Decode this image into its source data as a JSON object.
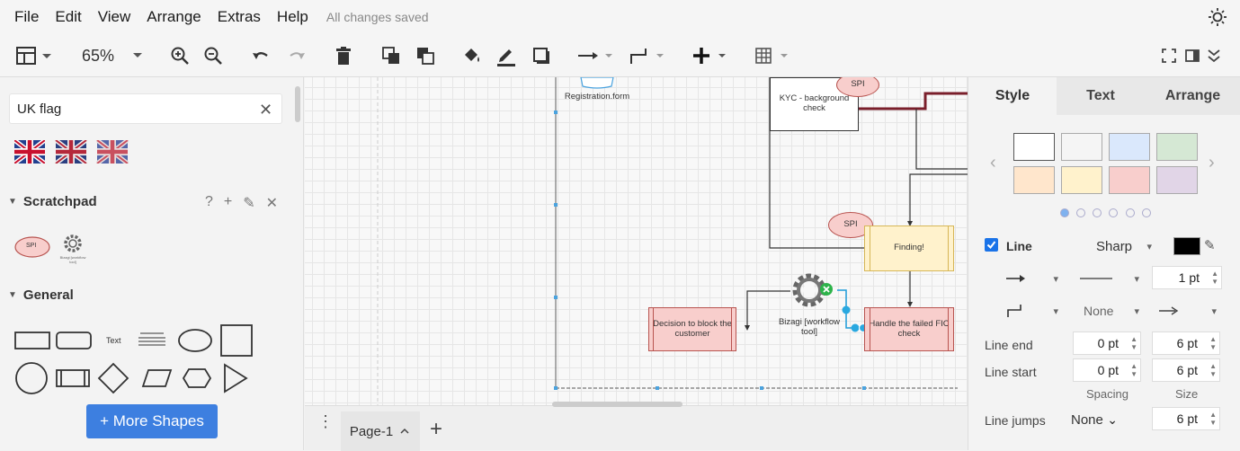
{
  "menu": {
    "file": "File",
    "edit": "Edit",
    "view": "View",
    "arrange": "Arrange",
    "extras": "Extras",
    "help": "Help",
    "status": "All changes saved"
  },
  "toolbar": {
    "zoom": "65%"
  },
  "sidebar": {
    "search": {
      "value": "UK flag"
    },
    "scratchpad": {
      "title": "Scratchpad",
      "help": "?",
      "add": "+"
    },
    "general": {
      "title": "General"
    },
    "scratch_items": {
      "spi": "SPI",
      "gear_caption": "Bizagi [workflow tool]"
    },
    "shape_text": "Text",
    "more_shapes": "+ More Shapes"
  },
  "diagram": {
    "registration": "Registration.form",
    "kyc": "KYC - background check",
    "spi_top": "SPI",
    "spi_mid": "SPI",
    "finding": "Finding!",
    "decision": "Decision to block the customer",
    "bizagi": "Bizagi [workflow tool]",
    "handle": "Handle the failed FIC check"
  },
  "pages": {
    "tab": "Page-1",
    "add": "+"
  },
  "format_panel": {
    "tabs": {
      "style": "Style",
      "text": "Text",
      "arrange": "Arrange"
    },
    "swatches": [
      "#ffffff",
      "#f5f5f5",
      "#dae8fc",
      "#d5e8d4",
      "#ffe6cc",
      "#fff2cc",
      "#f8cecc",
      "#e1d5e7"
    ],
    "line": {
      "label": "Line",
      "checked": true,
      "style": "Sharp",
      "color": "#000000",
      "width": "1 pt",
      "waypoint": "None"
    },
    "line_end": {
      "label": "Line end",
      "spacing": "0 pt",
      "size": "6 pt"
    },
    "line_start": {
      "label": "Line start",
      "spacing": "0 pt",
      "size": "6 pt"
    },
    "headers": {
      "spacing": "Spacing",
      "size": "Size"
    },
    "line_jumps": {
      "label": "Line jumps",
      "value": "None",
      "size": "6 pt"
    }
  }
}
